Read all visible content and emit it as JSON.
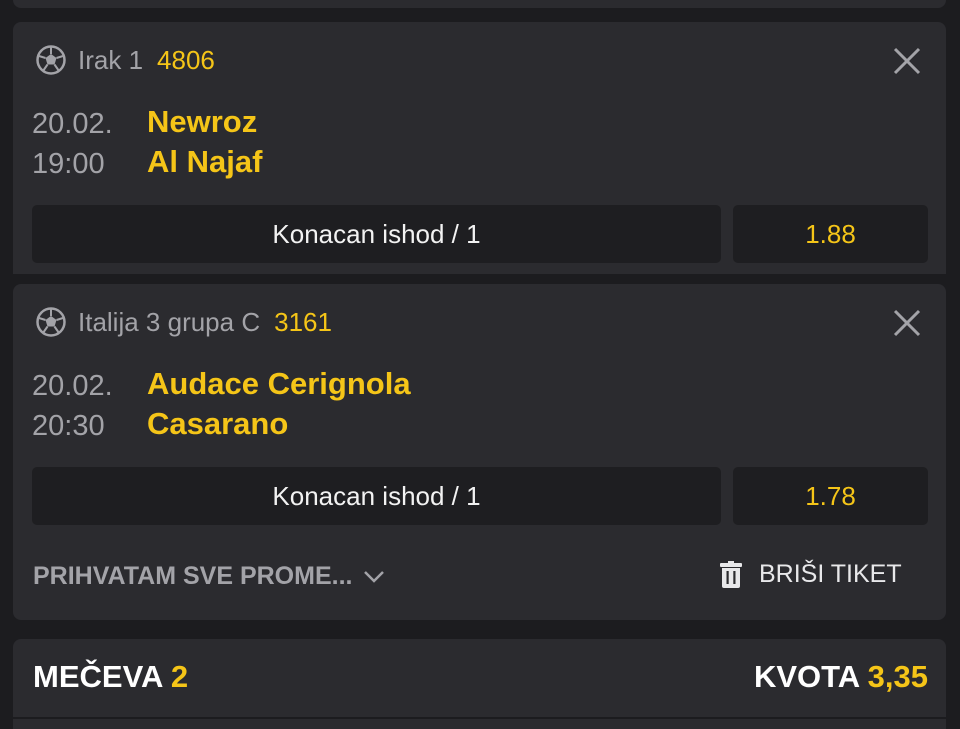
{
  "colors": {
    "background": "#1c1c1f",
    "card": "#2b2b2f",
    "accent": "#f5c518",
    "muted": "#a3a3a8",
    "text": "#ffffff"
  },
  "matches": [
    {
      "sport_icon": "soccer-ball-icon",
      "league": "Irak 1",
      "code": "4806",
      "date": "20.02.",
      "time": "19:00",
      "home": "Newroz",
      "away": "Al Najaf",
      "bet": "Konacan ishod / 1",
      "odd": "1.88"
    },
    {
      "sport_icon": "soccer-ball-icon",
      "league": "Italija 3 grupa C",
      "code": "3161",
      "date": "20.02.",
      "time": "20:30",
      "home": "Audace Cerignola",
      "away": "Casarano",
      "bet": "Konacan ishod / 1",
      "odd": "1.78"
    }
  ],
  "footer": {
    "accept_label": "PRIHVATAM SVE PROME...",
    "accept_icon": "chevron-down-icon",
    "delete_label": "BRIŠI TIKET",
    "delete_icon": "trash-icon"
  },
  "summary": {
    "matches_label": "MEČEVA",
    "matches_count": "2",
    "odd_label": "KVOTA",
    "odd_value": "3,35"
  }
}
